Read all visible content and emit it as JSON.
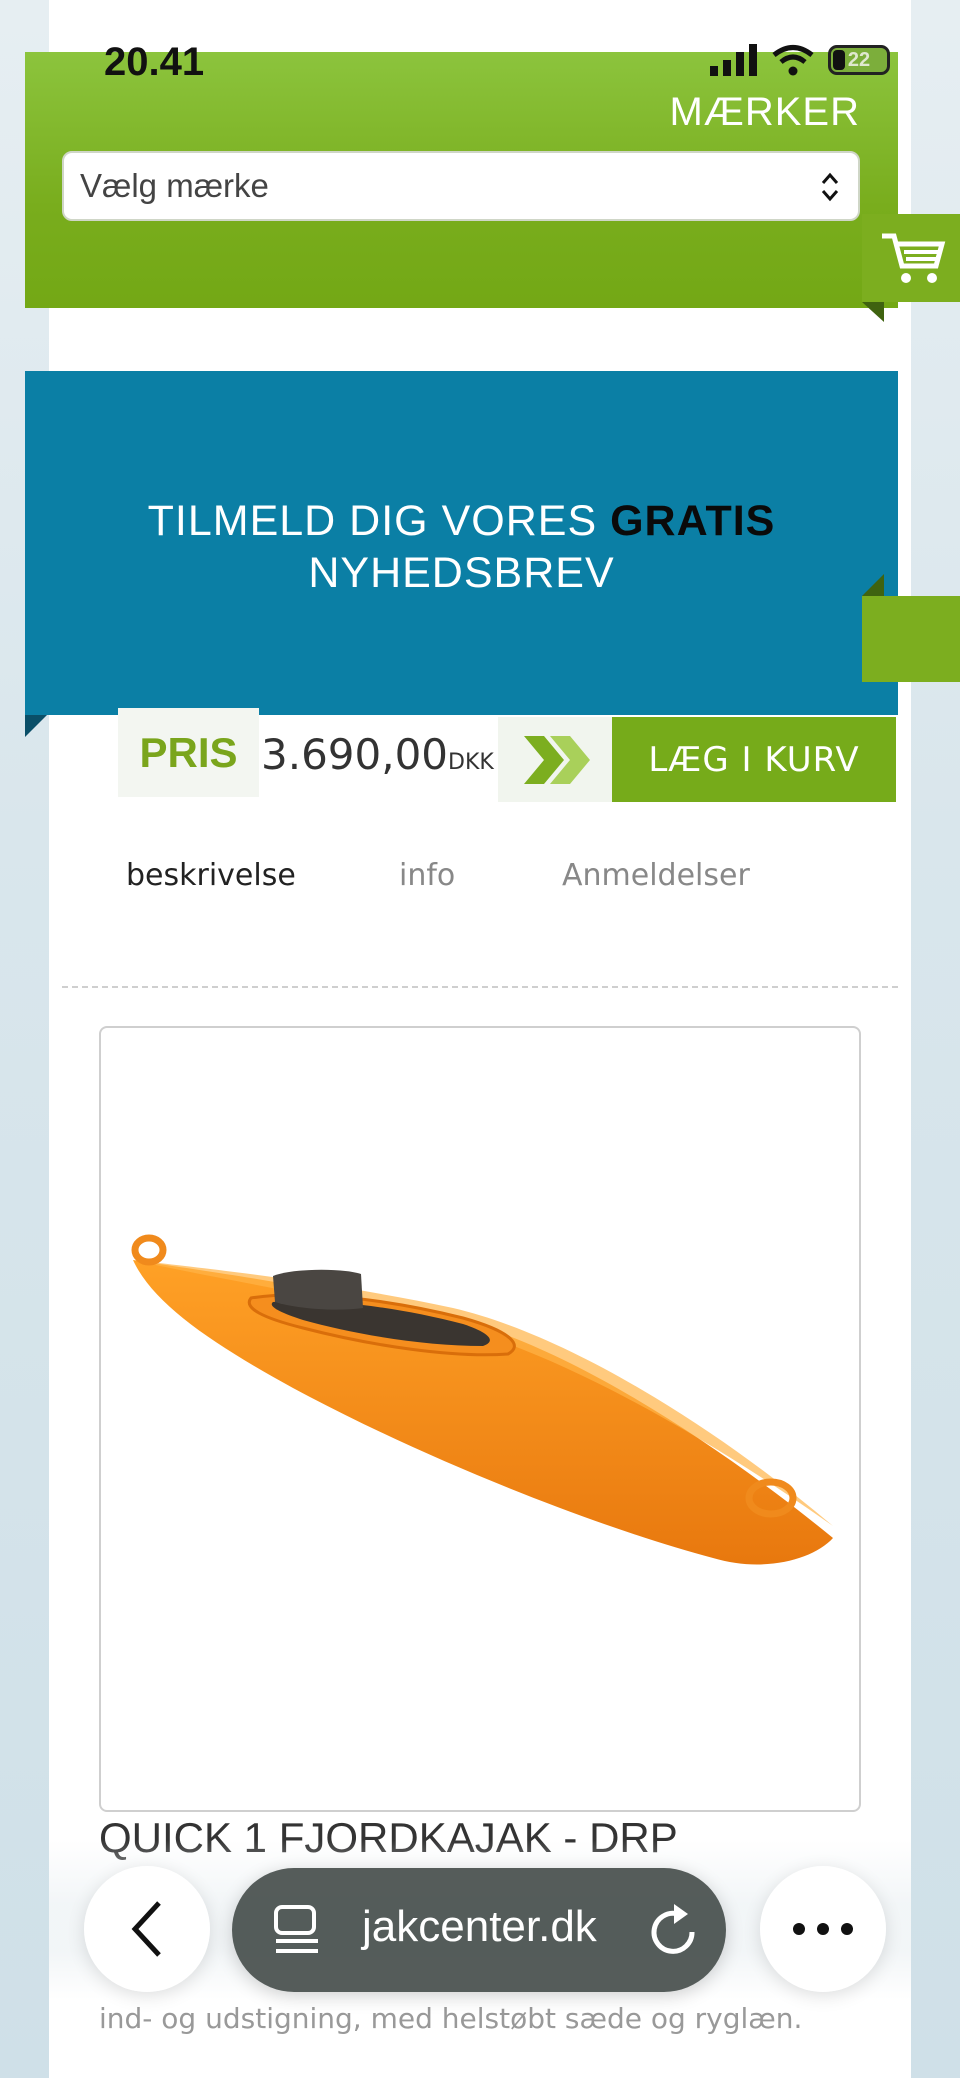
{
  "status_bar": {
    "time": "20.41",
    "battery": "22"
  },
  "header": {
    "brands_title": "MÆRKER",
    "brand_select_value": "Vælg mærke"
  },
  "newsletter": {
    "line1_prefix": "TILMELD DIG VORES ",
    "line1_strong": "GRATIS",
    "line2": "NYHEDSBREV"
  },
  "price": {
    "label": "PRIS",
    "value": "3.690,00",
    "currency": "DKK",
    "add_to_cart": "LÆG I KURV"
  },
  "tabs": [
    {
      "label": "beskrivelse",
      "active": true
    },
    {
      "label": "info",
      "active": false
    },
    {
      "label": "Anmeldelser",
      "active": false
    }
  ],
  "product": {
    "title": "QUICK 1 FJORDKAJAK - DRP",
    "description_last_line": "ind- og udstigning, med helstøbt sæde og ryglæn.",
    "image_alt": "Orange kajak"
  },
  "browser": {
    "url": "jakcenter.dk"
  },
  "colors": {
    "green": "#79ad1d",
    "blue": "#0b7fa5",
    "orange": "#f08a1c"
  },
  "icons": [
    "signal-icon",
    "wifi-icon",
    "battery-icon",
    "select-arrows-icon",
    "cart-icon",
    "double-chevron-icon",
    "back-icon",
    "tabs-icon",
    "reload-icon",
    "more-icon"
  ]
}
